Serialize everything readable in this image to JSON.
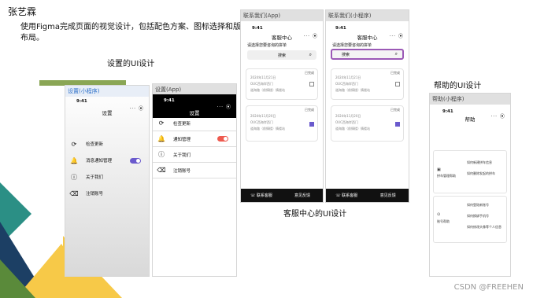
{
  "slide": {
    "author": "张艺霖",
    "description": "使用Figma完成页面的视觉设计，包括配色方案、图标选择和版面布局。",
    "caption_settings": "设置的UI设计",
    "caption_service": "客服中心的UI设计",
    "caption_help": "帮助的UI设计",
    "watermark": "CSDN @FREEHEN"
  },
  "colors": {
    "olive": "#8aa655",
    "navy": "#1c3f64",
    "teal": "#2b8f85",
    "yellow": "#f7c948",
    "green_dark": "#5a8a3a",
    "link": "#2b6fc9",
    "toggle_purple": "#6a5acd",
    "toggle_red": "#ee5a4f",
    "highlight": "#9b59b6"
  },
  "settings_mini": {
    "header": "设置(小程序)",
    "time": "9:41",
    "capsule": "··· ⦿",
    "title": "设置",
    "items": [
      {
        "icon": "refresh-icon",
        "label": "检查更新"
      },
      {
        "icon": "bell-icon",
        "label": "消息通知管理"
      },
      {
        "icon": "info-icon",
        "label": "关于我们"
      },
      {
        "icon": "delete-icon",
        "label": "注销账号"
      }
    ]
  },
  "settings_app": {
    "header": "设置(App)",
    "time": "9:41",
    "capsule": "··· ⦿",
    "title": "设置",
    "items": [
      {
        "icon": "refresh-icon",
        "label": "检查更新"
      },
      {
        "icon": "bell-icon",
        "label": "通知管理"
      },
      {
        "icon": "info-icon",
        "label": "关于我们"
      },
      {
        "icon": "delete-icon",
        "label": "注销账号"
      }
    ]
  },
  "service_app": {
    "header": "联系我们(App)",
    "time": "9:41",
    "capsule": "··· ⦿",
    "title": "客服中心",
    "prompt": "请选择您要咨询的拼单",
    "search_label": "搜索",
    "cards": [
      {
        "status": "已完成",
        "date": "2024年11月21日",
        "from": "OUC西海岸西门",
        "to": "道海路（前情楼）情楼站"
      },
      {
        "status": "已完成",
        "date": "2024年11月20日",
        "from": "OUC西海岸西门",
        "to": "道海路（前情楼）情楼站"
      }
    ],
    "bottom": [
      "联系客服",
      "意见反馈"
    ]
  },
  "service_mini": {
    "header": "联系我们(小程序)",
    "time": "9:41",
    "capsule": "··· ⦿",
    "title": "客服中心",
    "prompt": "请选择您要咨询的拼单",
    "search_label": "搜索",
    "cards": [
      {
        "status": "已完成",
        "date": "2024年11月21日",
        "from": "OUC西海岸西门",
        "to": "道海路（前情楼）情楼站"
      },
      {
        "status": "已完成",
        "date": "2024年11月20日",
        "from": "OUC西海岸西门",
        "to": "道海路（前情楼）情楼站"
      }
    ],
    "bottom": [
      "联系客服",
      "意见反馈"
    ]
  },
  "help_mini": {
    "header": "帮助(小程序)",
    "time": "9:41",
    "capsule": "··· ⦿",
    "title": "帮助",
    "groups": [
      {
        "category": "拼车管理帮助",
        "questions": [
          "如何新建拼车信息",
          "如何删除发起的拼车"
        ]
      },
      {
        "category": "账号帮助",
        "questions": [
          "如何登陆新账号",
          "如何换绑手机号",
          "如何修改头像等个人信息"
        ]
      }
    ]
  }
}
